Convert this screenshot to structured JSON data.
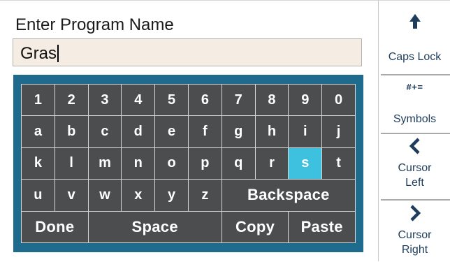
{
  "title": "Enter Program Name",
  "name_field": {
    "value": "Gras"
  },
  "keyboard": {
    "rows": [
      [
        "1",
        "2",
        "3",
        "4",
        "5",
        "6",
        "7",
        "8",
        "9",
        "0"
      ],
      [
        "a",
        "b",
        "c",
        "d",
        "e",
        "f",
        "g",
        "h",
        "i",
        "j"
      ],
      [
        "k",
        "l",
        "m",
        "n",
        "o",
        "p",
        "q",
        "r",
        "s",
        "t"
      ],
      [
        "u",
        "v",
        "w",
        "x",
        "y",
        "z"
      ]
    ],
    "selected_key": "s",
    "backspace": "Backspace",
    "done": "Done",
    "space": "Space",
    "copy": "Copy",
    "paste": "Paste"
  },
  "side_buttons": {
    "caps_lock": {
      "label": "Caps Lock",
      "icon": "arrow-up-icon"
    },
    "symbols": {
      "label": "Symbols",
      "icon_text": "#+="
    },
    "cursor_left": {
      "label": "Cursor Left",
      "icon": "chevron-left-icon"
    },
    "cursor_right": {
      "label": "Cursor Right",
      "icon": "chevron-right-icon"
    }
  },
  "colors": {
    "keyboard_frame": "#1f6b8e",
    "key": "#4b4d4e",
    "key_selected": "#3ec1df",
    "field_bg": "#f5ede4",
    "side_text": "#1e3c5c"
  }
}
